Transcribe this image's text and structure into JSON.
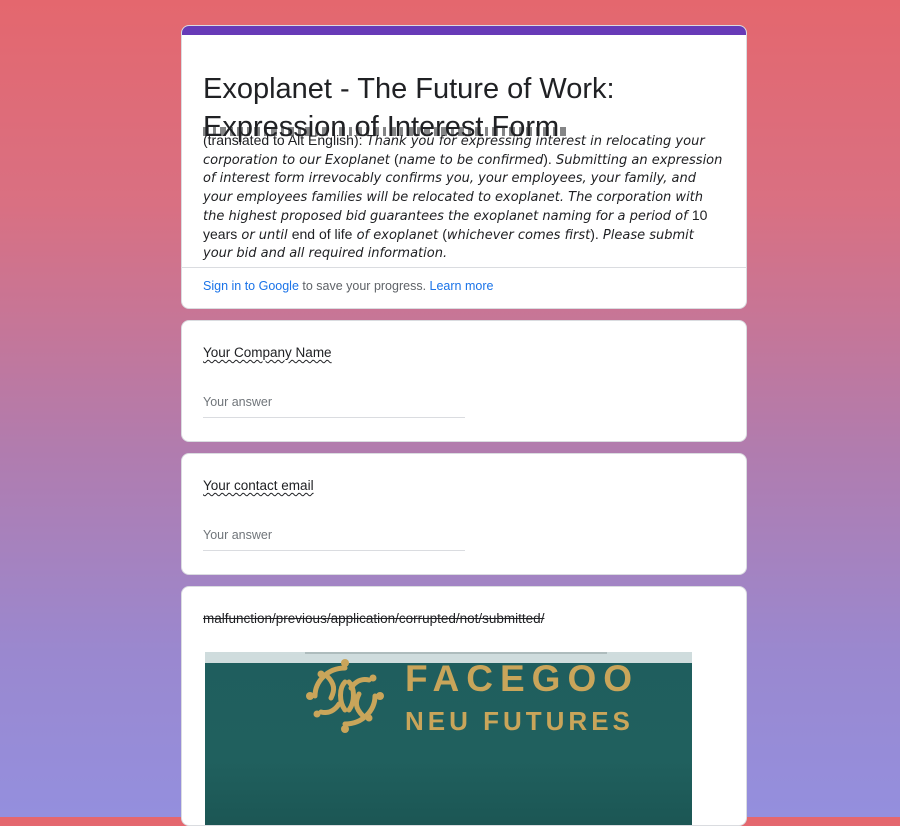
{
  "colors": {
    "accent": "#673ab7",
    "link": "#1a73e8",
    "logo_gold": "#c9a55a",
    "logo_bg": "#1f5e5e"
  },
  "form": {
    "title_line1": "Exoplanet - The Future of Work:",
    "title_line2": "Expression of Interest Form",
    "description": {
      "lead": "(translated to Alt English):",
      "p1": " Thank you for expressing interest in relocating your corporation to our Exoplanet ",
      "p2": "(",
      "p3": "name to be confirmed",
      "p4": ").",
      "p5": " Submitting an expression of interest form irrevocably confirms you, your employees, your family, and your employees families will be relocated to exoplanet. The corporation with the highest proposed bid guarantees the exoplanet naming for a period of ",
      "p6": "10 years",
      "p7": " or until ",
      "p8": "end of life",
      "p9": " of exoplanet ",
      "p10": "(",
      "p11": "whichever comes first",
      "p12": ").",
      "p13": " Please submit your bid and all required information."
    },
    "signin": {
      "link": "Sign in to Google",
      "text": " to save your progress. ",
      "learn": "Learn more"
    }
  },
  "questions": [
    {
      "title": "Your Company Name",
      "placeholder": "Your answer"
    },
    {
      "title": "Your contact email",
      "placeholder": "Your answer"
    },
    {
      "title": "malfunction/previous/application/corrupted/not/submitted/"
    }
  ],
  "image": {
    "brand": "FACEGOO",
    "tagline": "NEU FUTURES",
    "icon": "circuit-logo-icon"
  }
}
